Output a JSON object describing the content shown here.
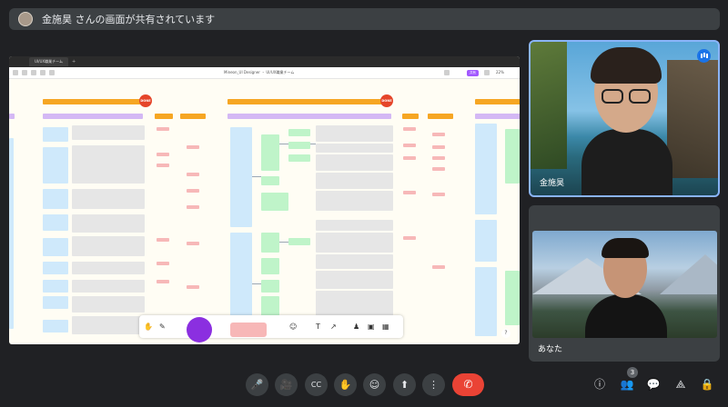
{
  "banner": {
    "text": "金施昊 さんの画面が共有されています"
  },
  "shared_screen": {
    "browser_tab": "UI/UX職業チーム",
    "breadcrumb": "Mineon_UI Designer ・ UI/UX職業チーム",
    "share_label": "共有",
    "zoom": "22%",
    "done_label": "DONE"
  },
  "video": {
    "tile1_name": "金施昊",
    "tile2_name": "あなた"
  },
  "controls": {
    "mic": "🎤",
    "camera": "🎥",
    "captions": "CC",
    "raise_hand": "✋",
    "emoji": "☺",
    "present": "⬆",
    "more": "⋮",
    "end_call": "✆"
  },
  "right_controls": {
    "info": "ⓘ",
    "people": "👥",
    "participant_count": "3",
    "chat": "💬",
    "activities": "⟁",
    "host": "🔒"
  },
  "colors": {
    "accent": "#8b2fe0",
    "done": "#e5452a",
    "end_call": "#ea4335"
  }
}
